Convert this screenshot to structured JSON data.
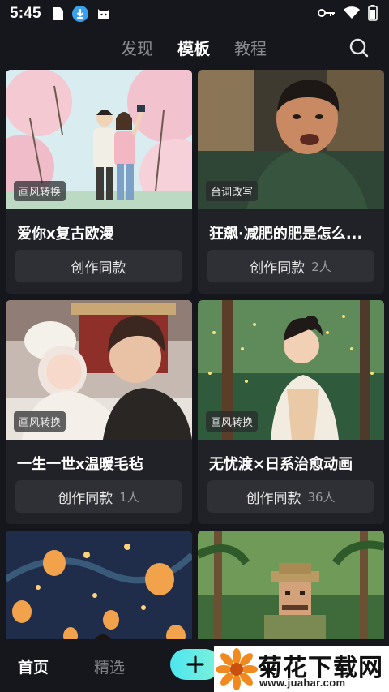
{
  "status_bar": {
    "time": "5:45"
  },
  "top_tabs": [
    {
      "label": "发现",
      "active": false
    },
    {
      "label": "模板",
      "active": true
    },
    {
      "label": "教程",
      "active": false
    }
  ],
  "cards": [
    {
      "tag": "画风转换",
      "title": "爱你x复古欧漫",
      "button_label": "创作同款",
      "count": ""
    },
    {
      "tag": "台词改写",
      "title": "狂飙·减肥的肥是怎么...",
      "button_label": "创作同款",
      "count": "2人"
    },
    {
      "tag": "画风转换",
      "title": "一生一世x温暖毛毡",
      "button_label": "创作同款",
      "count": "1人"
    },
    {
      "tag": "画风转换",
      "title": "无忧渡×日系治愈动画",
      "button_label": "创作同款",
      "count": "36人"
    }
  ],
  "bottom_nav": {
    "home_label": "首页",
    "featured_label": "精选"
  },
  "watermark": {
    "title": "菊花下载网",
    "url": "www.juahar.com"
  },
  "colors": {
    "background": "#16171c",
    "card": "#212227",
    "button": "#2f3036",
    "accent": "#4ee5f0"
  }
}
